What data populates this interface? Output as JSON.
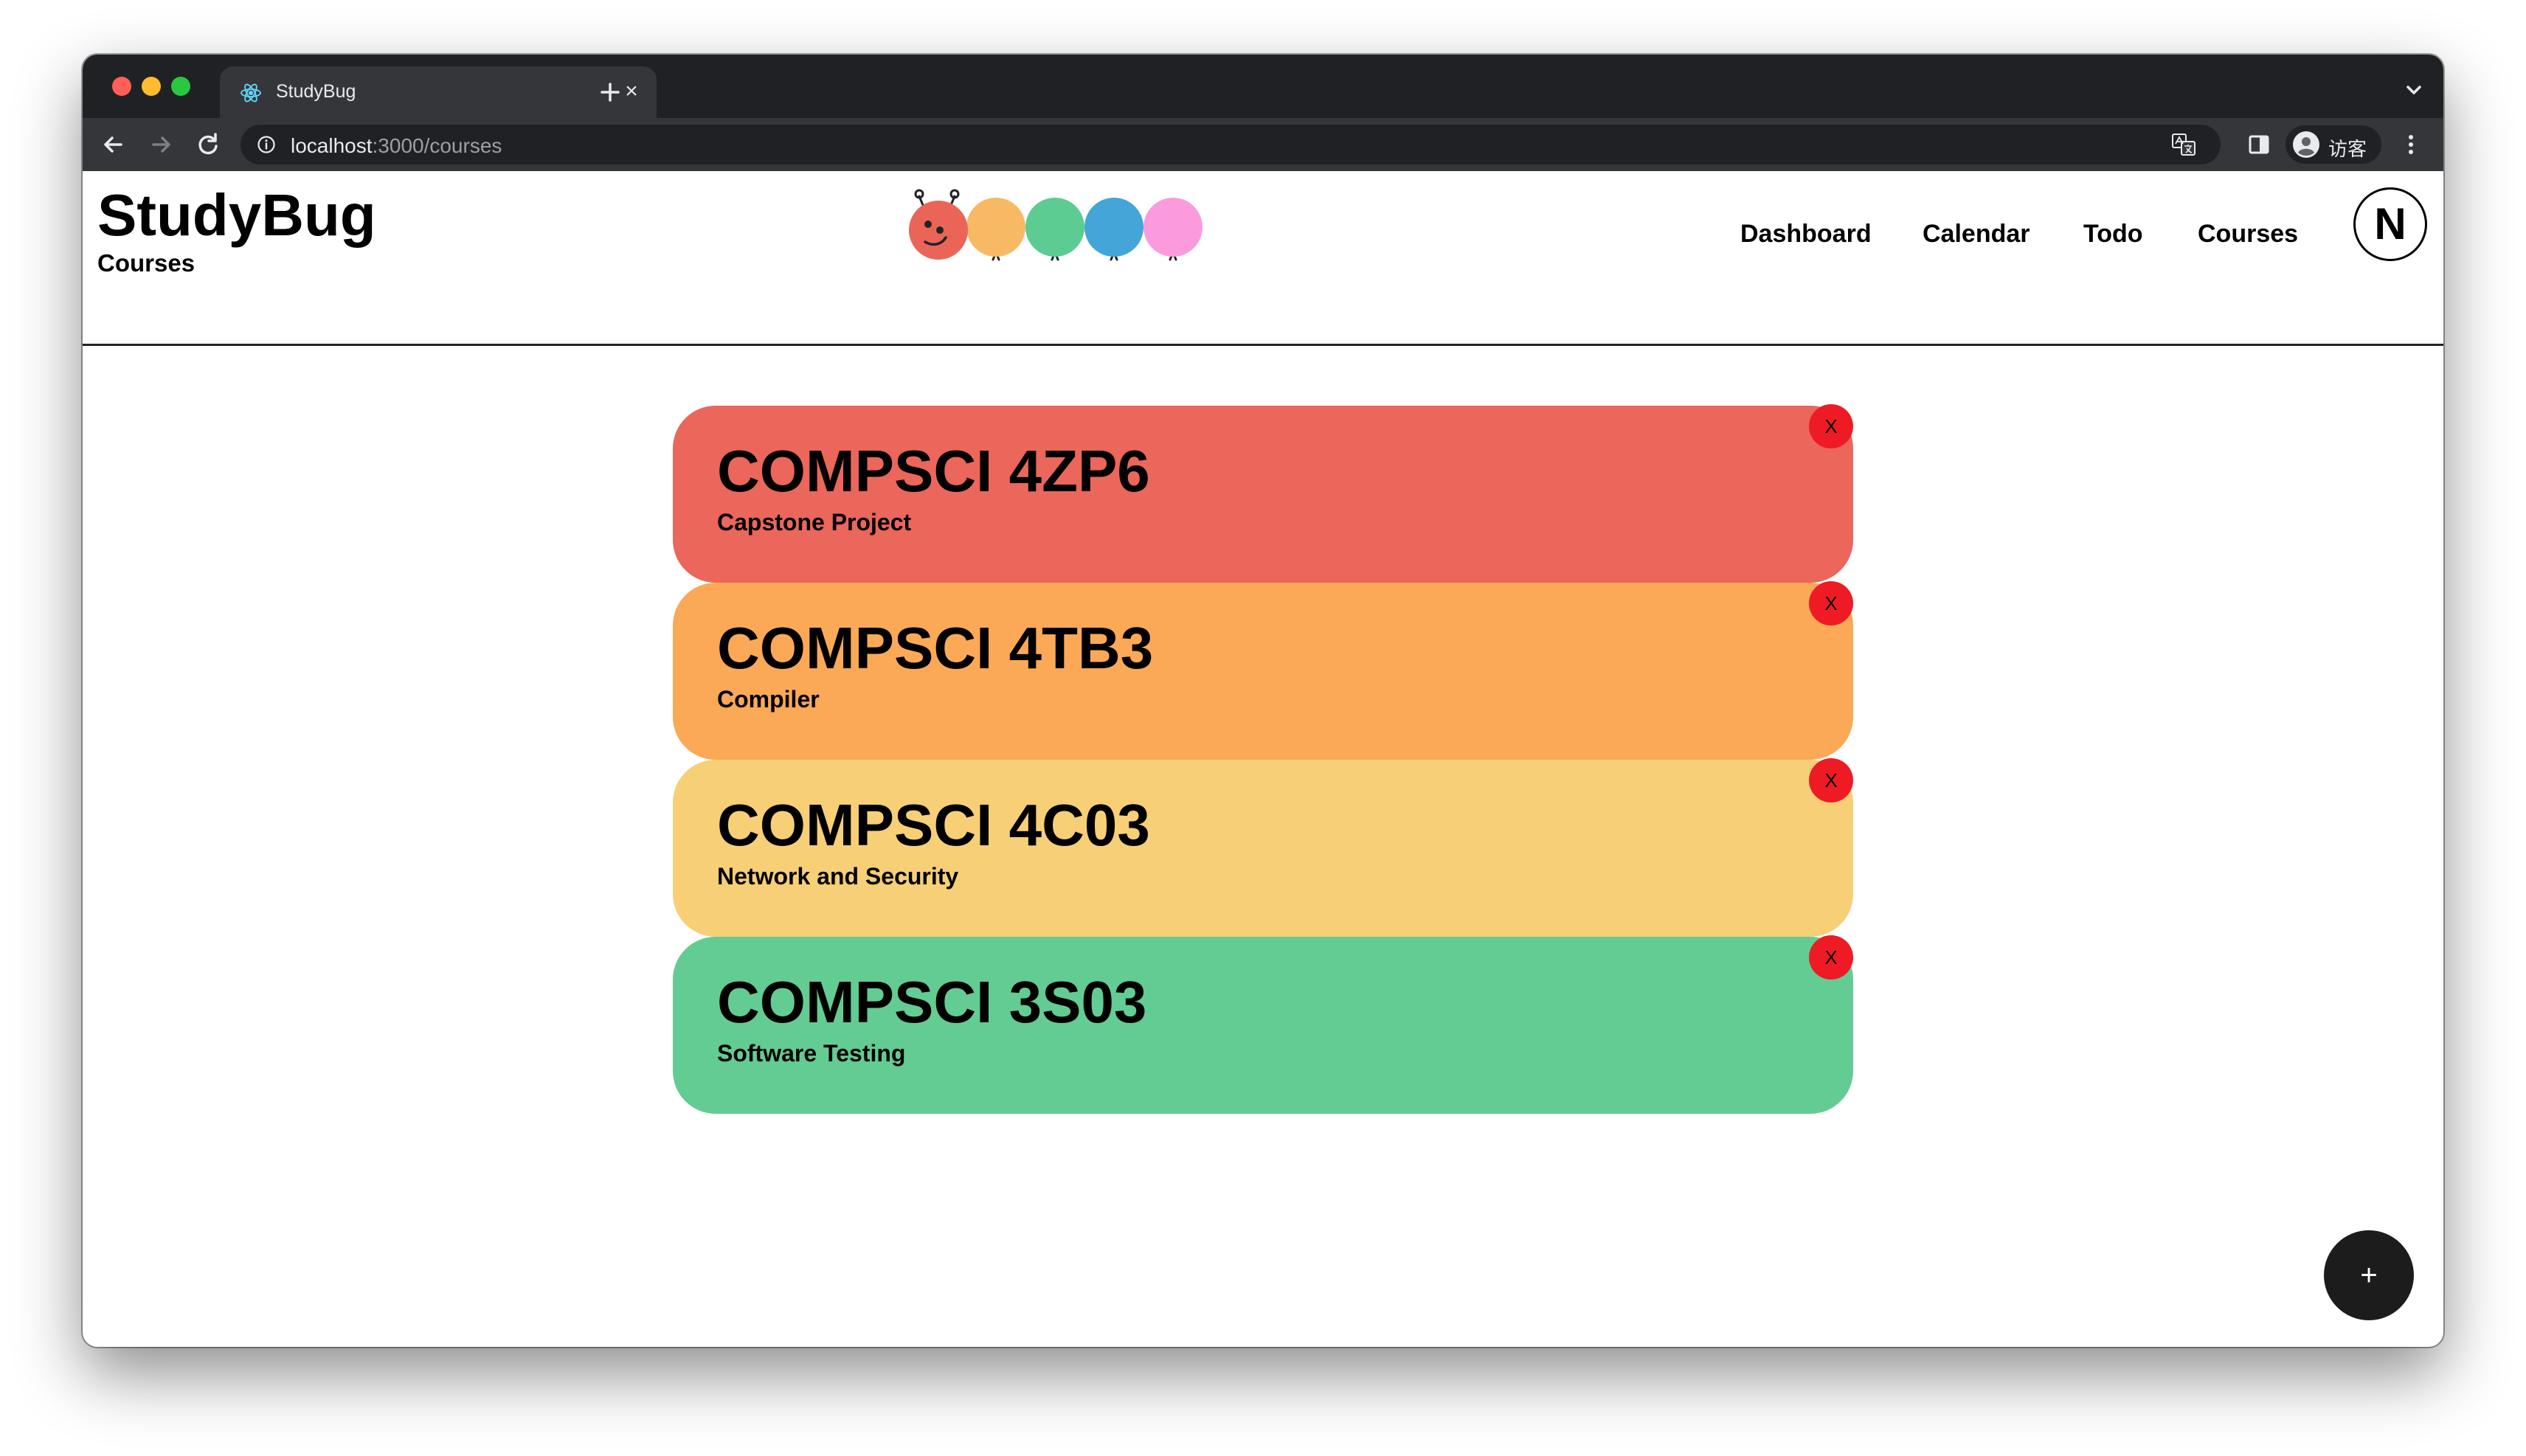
{
  "browser": {
    "tab_title": "StudyBug",
    "url_host": "localhost",
    "url_path": ":3000/courses",
    "profile_label": "访客",
    "traffic_colors": [
      "#ff5f57",
      "#febc2e",
      "#28c840"
    ]
  },
  "app": {
    "title": "StudyBug",
    "subtitle": "Courses",
    "nav": [
      "Dashboard",
      "Calendar",
      "Todo",
      "Courses"
    ],
    "avatar_initial": "N",
    "bug_colors": [
      "#ea6558",
      "#f8b964",
      "#5ccc92",
      "#43a5d8",
      "#fb9bde"
    ]
  },
  "courses": [
    {
      "code": "COMPSCI 4ZP6",
      "name": "Capstone Project",
      "color": "#eb665b",
      "delete_label": "X"
    },
    {
      "code": "COMPSCI 4TB3",
      "name": "Compiler",
      "color": "#fba956",
      "delete_label": "X"
    },
    {
      "code": "COMPSCI 4C03",
      "name": "Network and Security",
      "color": "#f7cf76",
      "delete_label": "X"
    },
    {
      "code": "COMPSCI 3S03",
      "name": "Software Testing",
      "color": "#63cc93",
      "delete_label": "X"
    }
  ],
  "fab_label": "+"
}
